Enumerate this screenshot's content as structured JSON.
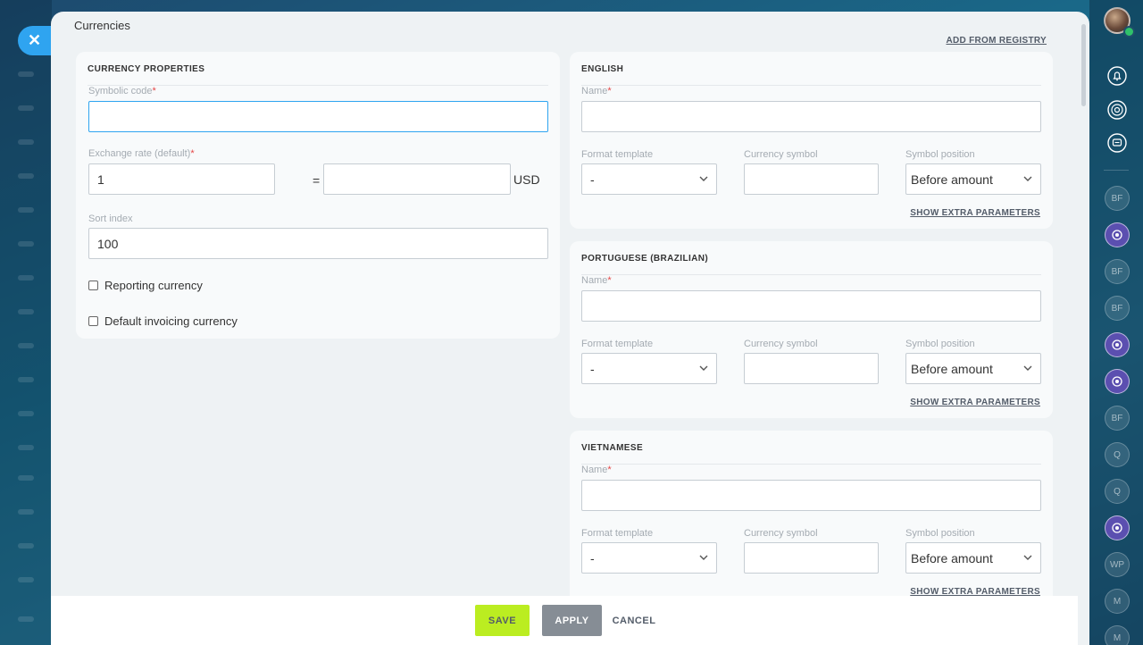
{
  "panel": {
    "title": "Currencies",
    "add_from_registry": "ADD FROM REGISTRY"
  },
  "currency_properties": {
    "title": "CURRENCY PROPERTIES",
    "symbolic_code": {
      "label": "Symbolic code",
      "required": "*",
      "value": ""
    },
    "exchange_rate": {
      "label": "Exchange rate (default)",
      "required": "*",
      "value": "1",
      "equals": "=",
      "base_value": "",
      "base_currency": "USD"
    },
    "sort_index": {
      "label": "Sort index",
      "value": "100"
    },
    "reporting_currency": {
      "label": "Reporting currency",
      "checked": false
    },
    "default_invoicing_currency": {
      "label": "Default invoicing currency",
      "checked": false
    }
  },
  "languages": [
    {
      "title": "ENGLISH",
      "name_label": "Name",
      "name_required": "*",
      "name_value": "",
      "format_label": "Format template",
      "format_value": "-",
      "symbol_label": "Currency symbol",
      "symbol_value": "",
      "position_label": "Symbol position",
      "position_value": "Before amount",
      "extra": "SHOW EXTRA PARAMETERS"
    },
    {
      "title": "PORTUGUESE (BRAZILIAN)",
      "name_label": "Name",
      "name_required": "*",
      "name_value": "",
      "format_label": "Format template",
      "format_value": "-",
      "symbol_label": "Currency symbol",
      "symbol_value": "",
      "position_label": "Symbol position",
      "position_value": "Before amount",
      "extra": "SHOW EXTRA PARAMETERS"
    },
    {
      "title": "VIETNAMESE",
      "name_label": "Name",
      "name_required": "*",
      "name_value": "",
      "format_label": "Format template",
      "format_value": "-",
      "symbol_label": "Currency symbol",
      "symbol_value": "",
      "position_label": "Symbol position",
      "position_value": "Before amount",
      "extra": "SHOW EXTRA PARAMETERS"
    }
  ],
  "footer": {
    "save": "SAVE",
    "apply": "APPLY",
    "cancel": "CANCEL"
  },
  "right_column": {
    "icons": [
      "bell-icon",
      "target-icon",
      "chat-icon"
    ],
    "badges": [
      "BF",
      "",
      "BF",
      "BF",
      "",
      "",
      "BF",
      "Q",
      "Q",
      "",
      "WP",
      "M",
      "M"
    ]
  },
  "colors": {
    "accent": "#2fa4f0",
    "save_button": "#bbed21",
    "apply_button": "#868d95",
    "required": "#e54545"
  }
}
